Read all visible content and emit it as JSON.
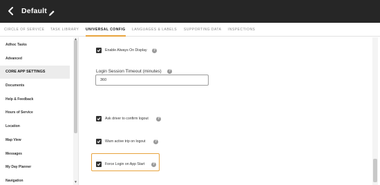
{
  "header": {
    "back_icon": "chevron-left-icon",
    "title": "Default",
    "edit_icon": "pencil-icon"
  },
  "tabs": [
    {
      "label": "CIRCLE OF SERVICE",
      "active": false
    },
    {
      "label": "TASK LIBRARY",
      "active": false
    },
    {
      "label": "UNIVERSAL CONFIG",
      "active": true
    },
    {
      "label": "LANGUAGES & LABELS",
      "active": false
    },
    {
      "label": "SUPPORTING DATA",
      "active": false
    },
    {
      "label": "INSPECTIONS",
      "active": false
    }
  ],
  "sidebar": {
    "items": [
      {
        "label": "Adhoc Tasks",
        "selected": false
      },
      {
        "label": "Advanced",
        "selected": false
      },
      {
        "label": "CORE APP SETTINGS",
        "selected": true
      },
      {
        "label": "Documents",
        "selected": false
      },
      {
        "label": "Help & Feedback",
        "selected": false
      },
      {
        "label": "Hours of Service",
        "selected": false
      },
      {
        "label": "Location",
        "selected": false
      },
      {
        "label": "Map View",
        "selected": false
      },
      {
        "label": "Messages",
        "selected": false
      },
      {
        "label": "My Day Planner",
        "selected": false
      },
      {
        "label": "Navigation",
        "selected": false
      }
    ]
  },
  "settings": {
    "enable_always_on_display": {
      "label": "Enable Always On Display",
      "checked": true
    },
    "login_session_timeout": {
      "label": "Login Session Timeout (minutes)",
      "value": "360"
    },
    "ask_driver_confirm_logout": {
      "label": "Ask driver to confirm logout",
      "checked": true
    },
    "warn_active_trip_logout": {
      "label": "Warn active trip on logout",
      "checked": true
    },
    "force_login_app_start": {
      "label": "Force Login on App Start",
      "checked": true
    }
  },
  "info_icon_glyph": "?",
  "colors": {
    "header_bg": "#262626",
    "accent": "#e8a33c",
    "selected_bg": "#ececec"
  }
}
